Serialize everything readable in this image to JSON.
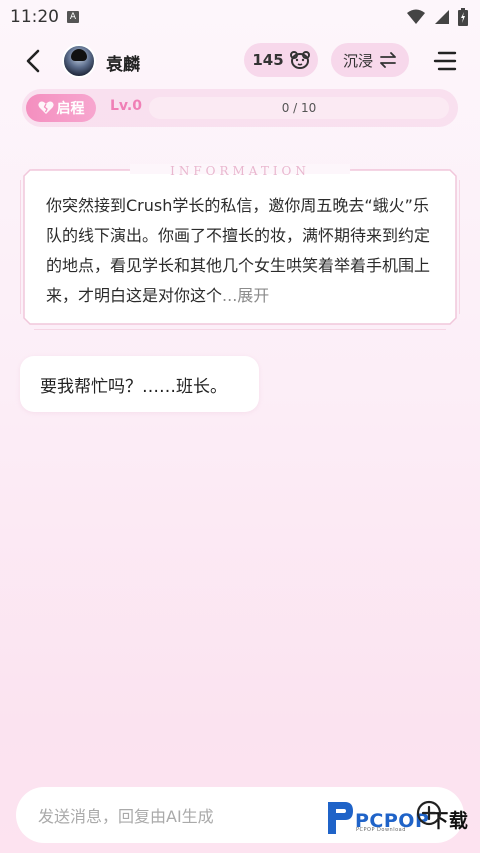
{
  "status_bar": {
    "time": "11:20",
    "badge": "A"
  },
  "header": {
    "character_name": "袁麟",
    "coins": "145",
    "mode_label": "沉浸"
  },
  "level": {
    "stage_label": "启程",
    "level_label": "Lv.0",
    "progress_text": "0 / 10",
    "progress_fraction": 0.0
  },
  "info_card": {
    "title": "INFORMATION",
    "text": "你突然接到Crush学长的私信，邀你周五晚去“蛾火”乐队的线下演出。你画了不擅长的妆，满怀期待来到约定的地点，看见学长和其他几个女生哄笑着举着手机围上来，才明白这是对你这个",
    "ellipsis": "...",
    "expand_label": "展开"
  },
  "messages": [
    {
      "text": "要我帮忙吗？……班长。"
    }
  ],
  "composer": {
    "placeholder": "发送消息，回复由AI生成"
  },
  "watermark": {
    "brand": "PCPOP",
    "brand_suffix": "下载",
    "sub": "PCPOP Download"
  },
  "colors": {
    "accent_pink": "#f07fb6",
    "badge_gradient_start": "#f48fbf",
    "progress_track": "#fbeaf3"
  }
}
